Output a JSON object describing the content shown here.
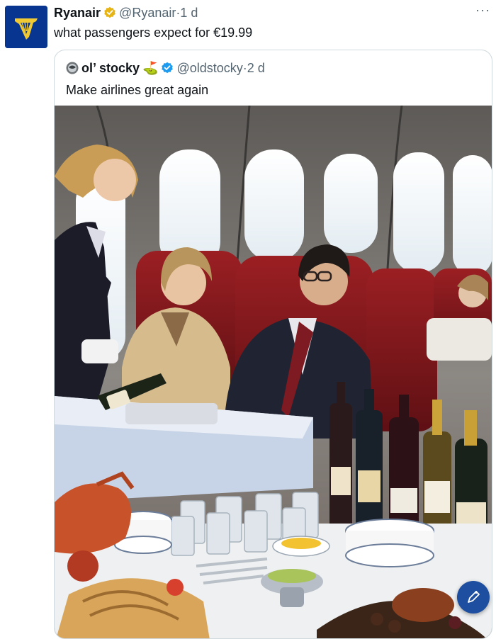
{
  "tweet": {
    "author_name": "Ryanair",
    "handle": "@Ryanair",
    "separator": "·",
    "time": "1 d",
    "text": "what passengers expect for €19.99",
    "more": "···"
  },
  "quoted": {
    "author_name": "ol’ stocky",
    "golf_emoji": "⛳",
    "handle": "@oldstocky",
    "separator": "·",
    "time": "2 d",
    "text": "Make airlines great again"
  },
  "icons": {
    "avatar": "ryanair-harp-logo",
    "verified": "verified-badge-icon",
    "quote_verified": "verified-blue-icon",
    "compose": "compose-icon"
  },
  "colors": {
    "ryanair_blue": "#073590",
    "gold_badge": "#e7b416",
    "blue_badge": "#1d9bf0",
    "fab": "#1d4e9f"
  }
}
